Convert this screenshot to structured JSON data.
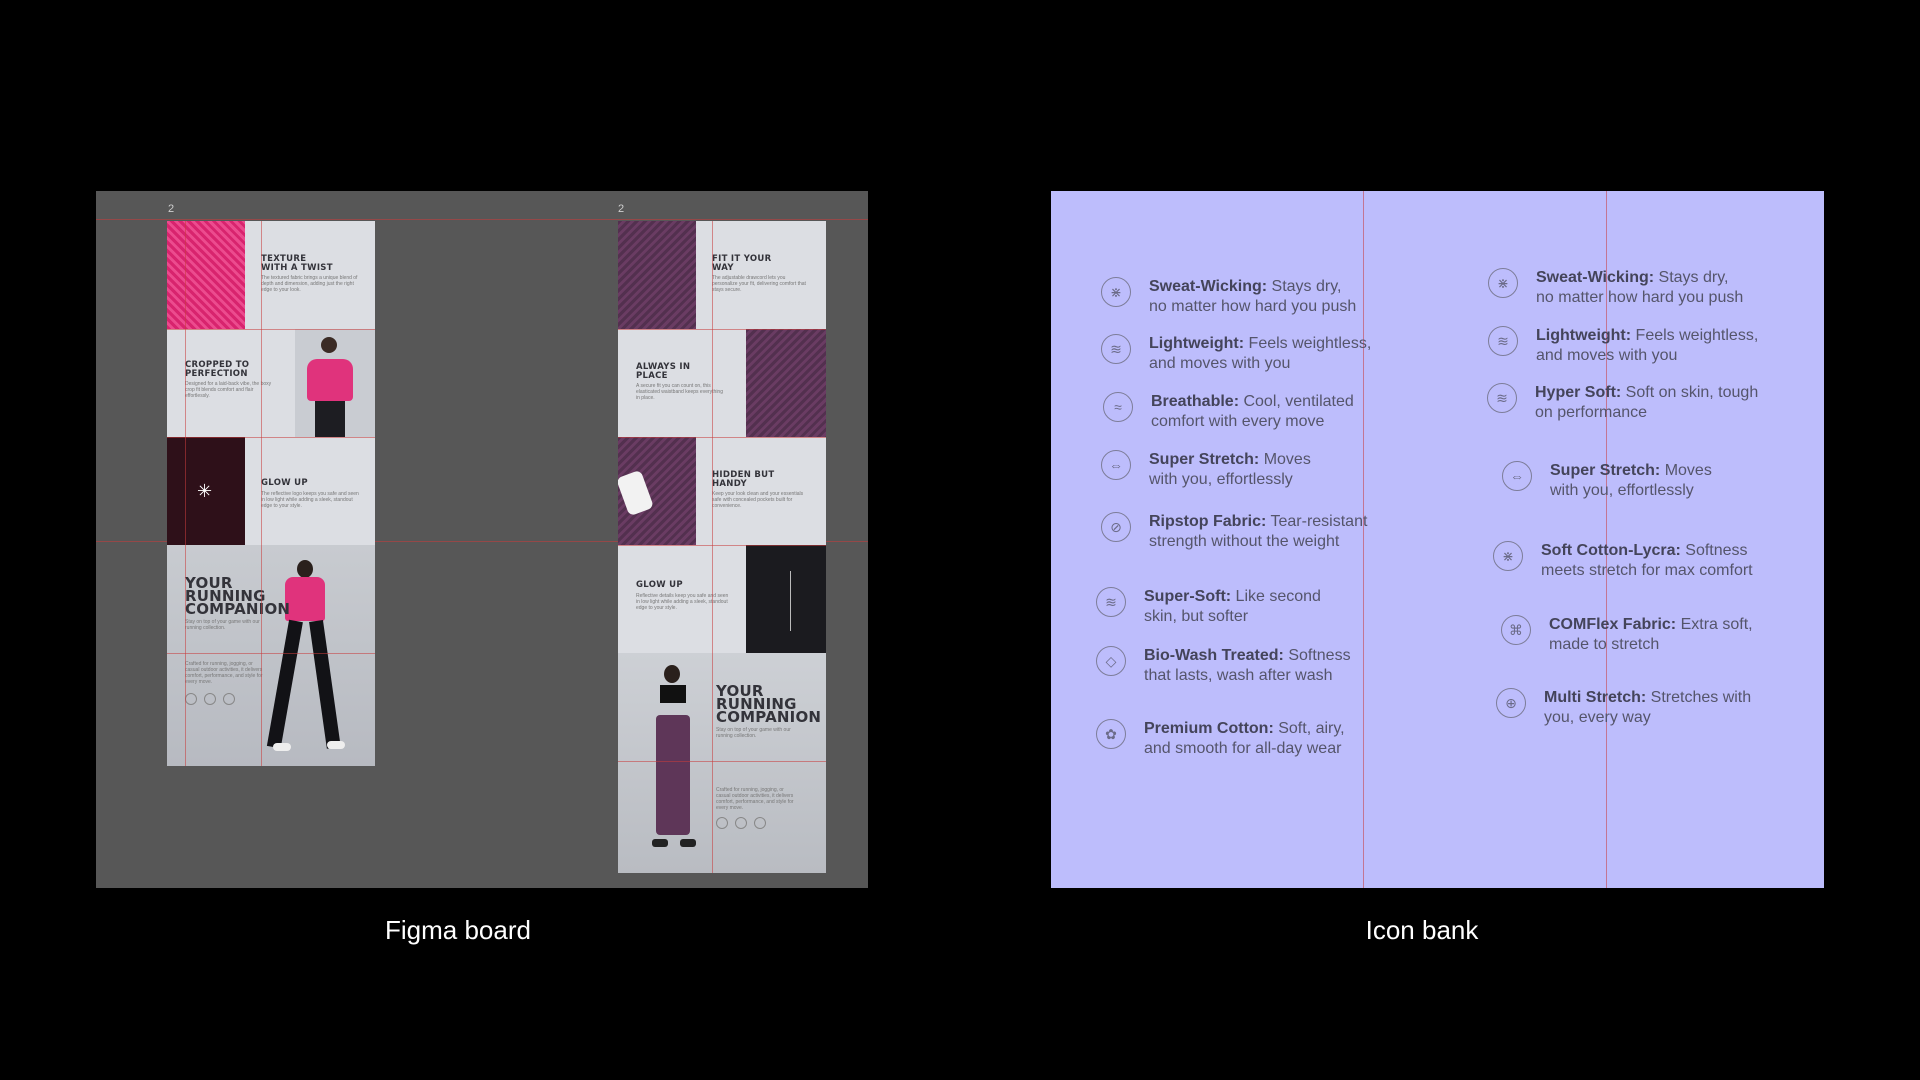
{
  "captions": {
    "figma_board": "Figma board",
    "icon_bank": "Icon bank"
  },
  "figma_board": {
    "frame_numbers": [
      "2",
      "2"
    ],
    "left_frame": {
      "texture_title": "TEXTURE\nWITH A TWIST",
      "texture_body": "The textured fabric brings a unique blend of depth and dimension, adding just the right edge to your look.",
      "cropped_title": "CROPPED TO\nPERFECTION",
      "cropped_body": "Designed for a laid-back vibe, the boxy crop fit blends comfort and flair effortlessly.",
      "glow_title": "GLOW UP",
      "glow_body": "The reflective logo keeps you safe and seen in low light while adding a sleek, standout edge to your style.",
      "hero_title": "YOUR\nRUNNING\nCOMPANION",
      "hero_sub": "Stay on top of your game with our running collection.",
      "hero_body": "Crafted for running, jogging, or casual outdoor activities, it delivers comfort, performance, and style for every move."
    },
    "right_frame": {
      "fit_title": "FIT IT YOUR\nWAY",
      "fit_body": "The adjustable drawcord lets you personalize your fit, delivering comfort that stays secure.",
      "place_title": "ALWAYS IN\nPLACE",
      "place_body": "A secure fit you can count on, this elasticated waistband keeps everything in place.",
      "pocket_title": "HIDDEN BUT\nHANDY",
      "pocket_body": "Keep your look clean and your essentials safe with concealed pockets built for convenience.",
      "glow_title": "GLOW UP",
      "glow_body": "Reflective details keep you safe and seen in low light while adding a sleek, standout edge to your style.",
      "hero_title": "YOUR\nRUNNING\nCOMPANION",
      "hero_sub": "Stay on top of your game with our running collection.",
      "hero_body": "Crafted for running, jogging, or casual outdoor activities, it delivers comfort, performance, and style for every move."
    }
  },
  "icon_bank": {
    "left_column": [
      {
        "icon": "sweat-wicking-icon",
        "bold": "Sweat-Wicking:",
        "line1": " Stays dry,",
        "line2": "no matter how hard you push"
      },
      {
        "icon": "feather-icon",
        "bold": "Lightweight:",
        "line1": " Feels weightless,",
        "line2": "and moves with you"
      },
      {
        "icon": "breathable-icon",
        "bold": "Breathable:",
        "line1": " Cool, ventilated",
        "line2": "comfort with every move"
      },
      {
        "icon": "stretch-icon",
        "bold": "Super Stretch:",
        "line1": " Moves",
        "line2": "with you, effortlessly"
      },
      {
        "icon": "ripstop-icon",
        "bold": "Ripstop Fabric:",
        "line1": " Tear-resistant",
        "line2": "strength without the weight"
      },
      {
        "icon": "feather-icon",
        "bold": "Super-Soft:",
        "line1": " Like second",
        "line2": "skin, but softer"
      },
      {
        "icon": "water-drop-icon",
        "bold": "Bio-Wash Treated:",
        "line1": " Softness",
        "line2": "that lasts, wash after wash"
      },
      {
        "icon": "cotton-icon",
        "bold": "Premium Cotton:",
        "line1": " Soft, airy,",
        "line2": "and smooth for all-day wear"
      }
    ],
    "right_column": [
      {
        "icon": "sweat-wicking-icon",
        "bold": "Sweat-Wicking:",
        "line1": " Stays dry,",
        "line2": "no matter how hard you push"
      },
      {
        "icon": "feather-icon",
        "bold": "Lightweight:",
        "line1": " Feels weightless,",
        "line2": "and moves with you"
      },
      {
        "icon": "hand-soft-icon",
        "bold": "Hyper Soft:",
        "line1": " Soft on skin, tough",
        "line2": "on performance"
      },
      {
        "icon": "stretch-icon",
        "bold": "Super Stretch:",
        "line1": " Moves",
        "line2": "with you, effortlessly"
      },
      {
        "icon": "sweat-wicking-icon",
        "bold": "Soft Cotton-Lycra:",
        "line1": "  Softness",
        "line2": "meets stretch for max comfort"
      },
      {
        "icon": "comflex-icon",
        "bold": "COMFlex Fabric:",
        "line1": " Extra soft,",
        "line2": "made to stretch"
      },
      {
        "icon": "multi-stretch-icon",
        "bold": "Multi Stretch:",
        "line1": " Stretches with",
        "line2": "you, every way"
      }
    ]
  },
  "colors": {
    "background": "#000000",
    "board_background": "#575757",
    "bank_background": "#bdbdfc",
    "guide_line": "#c83c3c",
    "pink_product": "#e23a80",
    "purple_product": "#5e3658"
  }
}
